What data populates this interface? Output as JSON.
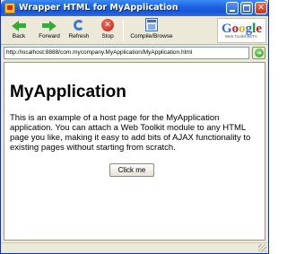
{
  "window": {
    "title": "Wrapper HTML for MyApplication"
  },
  "toolbar": {
    "back_label": "Back",
    "forward_label": "Forward",
    "refresh_label": "Refresh",
    "stop_label": "Stop",
    "compile_label": "Compile/Browse"
  },
  "branding": {
    "logo_text": "Google",
    "logo_subtext": "Web Toolkit BETA"
  },
  "address": {
    "url": "http://localhost:8888/com.mycompany.MyApplication/MyApplication.html"
  },
  "page": {
    "title": "MyApplication",
    "body": "This is an example of a host page for the MyApplication application. You can attach a Web Toolkit module to any HTML page you like, making it easy to add bits of AJAX functionality to existing pages without starting from scratch.",
    "button_label": "Click me"
  },
  "colors": {
    "titlebar": "#1f63e0",
    "chrome": "#ece9d8",
    "go_button": "#2f9c2a",
    "stop_button": "#c71c12"
  }
}
